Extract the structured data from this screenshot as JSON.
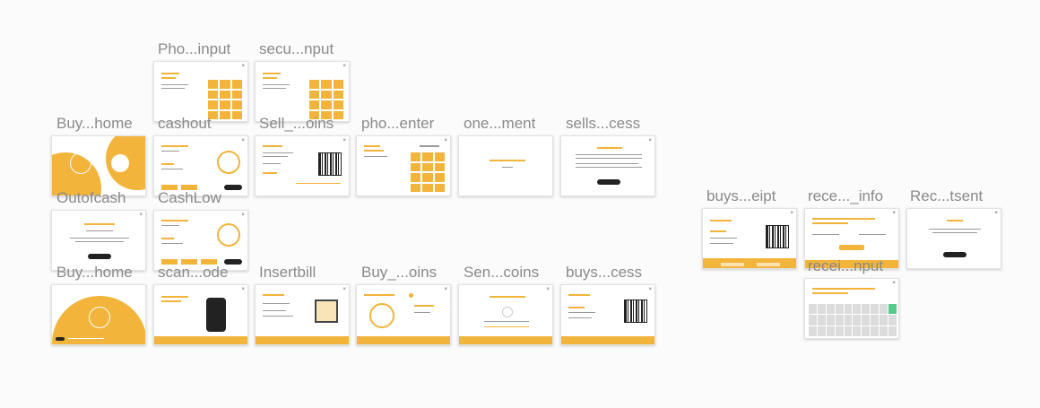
{
  "canvas_title": "",
  "colors": {
    "accent": "#f2b43a",
    "background": "#fbfbfb",
    "frame": "#ffffff",
    "label": "#8a8a8a"
  },
  "labels": {
    "phone_input": "Pho...input",
    "security_input": "secu...nput",
    "buy_home_1": "Buy...home",
    "cashout": "cashout",
    "sell_coins": "Sell_...oins",
    "phone_enter": "pho...enter",
    "one_moment": "one...ment",
    "sells_success": "sells...cess",
    "outofcash": "Outofcash",
    "cashlow": "CashLow",
    "buy_home_2": "Buy...home",
    "scan_code": "scan...ode",
    "insertbill": "Insertbill",
    "buy_coins": "Buy_...oins",
    "send_coins": "Sen...coins",
    "buys_success": "buys...cess",
    "buys_receipt": "buys...eipt",
    "receipt_info": "rece..._info",
    "receipt_sent": "Rec...tsent",
    "receipt_input": "recei...nput"
  },
  "icons": [
    "close-icon",
    "qr-code-icon",
    "keypad-icon",
    "bill-icon",
    "phone-icon"
  ]
}
